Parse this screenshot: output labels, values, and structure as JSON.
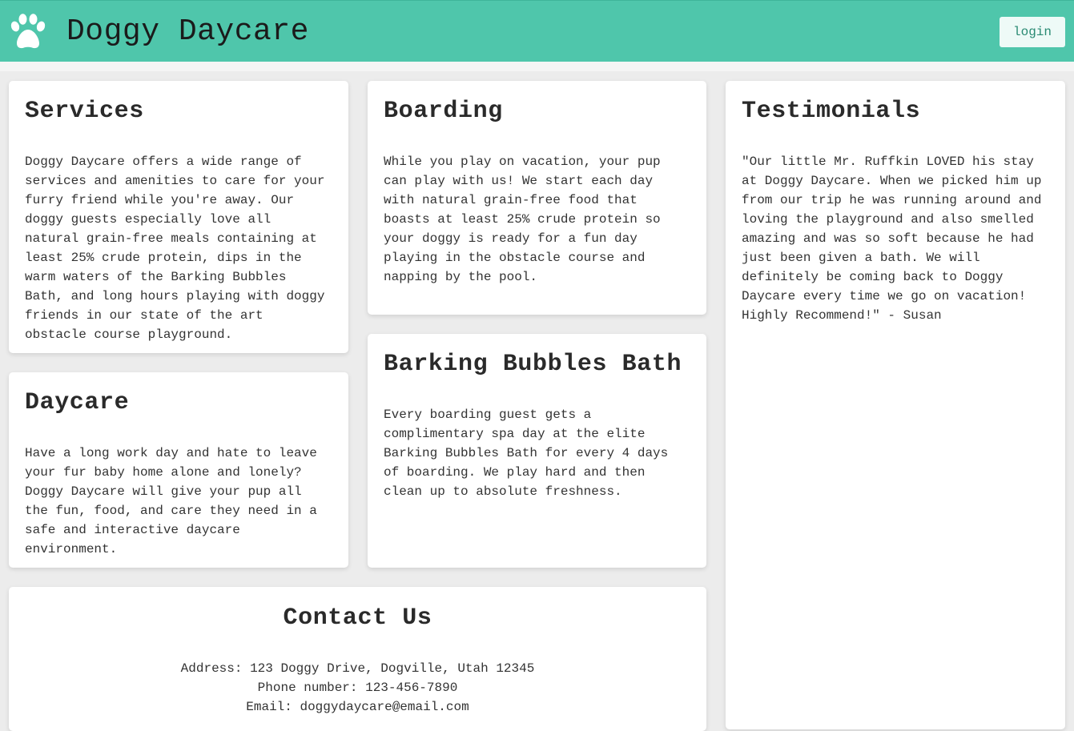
{
  "header": {
    "logo_icon": "paw-icon",
    "title": "Doggy Daycare",
    "login_label": "login",
    "bg_color": "#4fc6ab"
  },
  "cards": {
    "services": {
      "title": "Services",
      "body": "Doggy Daycare offers a wide range of services and amenities to care for your furry friend while you're away. Our doggy guests especially love all natural grain-free meals containing at least 25% crude protein, dips in the warm waters of the Barking Bubbles Bath, and long hours playing with doggy friends in our state of the art obstacle course playground."
    },
    "daycare": {
      "title": "Daycare",
      "body": "Have a long work day and hate to leave your fur baby home alone and lonely? Doggy Daycare will give your pup all the fun, food, and care they need in a safe and interactive daycare environment."
    },
    "boarding": {
      "title": "Boarding",
      "body": "While you play on vacation, your pup can play with us! We start each day with natural grain-free food that boasts at least 25% crude protein so your doggy is ready for a fun day playing in the obstacle course and napping by the pool."
    },
    "bath": {
      "title": "Barking Bubbles Bath",
      "body": "Every boarding guest gets a complimentary spa day at the elite Barking Bubbles Bath for every 4 days of boarding. We play hard and then clean up to absolute freshness."
    },
    "testimonials": {
      "title": "Testimonials",
      "body": "\"Our little Mr. Ruffkin LOVED his stay at Doggy Daycare. When we picked him up from our trip he was running around and loving the playground and also smelled amazing and was so soft because he had just been given a bath. We will definitely be coming back to Doggy Daycare every time we go on vacation! Highly Recommend!\" - Susan"
    },
    "contact": {
      "title": "Contact Us",
      "address": "Address: 123 Doggy Drive, Dogville, Utah 12345",
      "phone": "Phone number: 123-456-7890",
      "email": "Email: doggydaycare@email.com"
    }
  }
}
